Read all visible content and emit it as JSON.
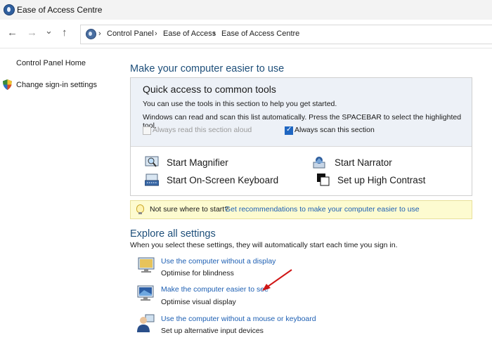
{
  "window": {
    "title": "Ease of Access Centre"
  },
  "nav": {
    "back_glyph": "←",
    "forward_glyph": "→",
    "recent_glyph": "⌄",
    "up_glyph": "↑"
  },
  "breadcrumb": {
    "separator": "›",
    "items": [
      "Control Panel",
      "Ease of Access",
      "Ease of Access Centre"
    ]
  },
  "sidebar": {
    "home": "Control Panel Home",
    "signin": "Change sign-in settings"
  },
  "main": {
    "title": "Make your computer easier to use",
    "quick_access": {
      "heading": "Quick access to common tools",
      "line1": "You can use the tools in this section to help you get started.",
      "line2": "Windows can read and scan this list automatically.  Press the SPACEBAR to select the highlighted tool.",
      "read_aloud": {
        "label": "Always read this section aloud",
        "checked": false
      },
      "scan": {
        "label": "Always scan this section",
        "checked": true
      },
      "tools": [
        {
          "label": "Start Magnifier",
          "icon": "magnifier-icon"
        },
        {
          "label": "Start Narrator",
          "icon": "narrator-icon"
        },
        {
          "label": "Start On-Screen Keyboard",
          "icon": "keyboard-icon"
        },
        {
          "label": "Set up High Contrast",
          "icon": "high-contrast-icon"
        }
      ]
    },
    "tip": {
      "text": "Not sure where to start?",
      "link": "Get recommendations to make your computer easier to use"
    },
    "explore": {
      "title": "Explore all settings",
      "description": "When you select these settings, they will automatically start each time you sign in.",
      "options": [
        {
          "link": "Use the computer without a display",
          "sub": "Optimise for blindness",
          "icon": "display-icon"
        },
        {
          "link": "Make the computer easier to see",
          "sub": "Optimise visual display",
          "icon": "monitor-icon"
        },
        {
          "link": "Use the computer without a mouse or keyboard",
          "sub": "Set up alternative input devices",
          "icon": "user-icon"
        }
      ]
    }
  },
  "colors": {
    "heading": "#1e4f7a",
    "link": "#1d5fb3",
    "quick_access_bg": "#edf1f7",
    "tip_bg": "#fdfbd0",
    "annotation_arrow": "#d01616"
  }
}
